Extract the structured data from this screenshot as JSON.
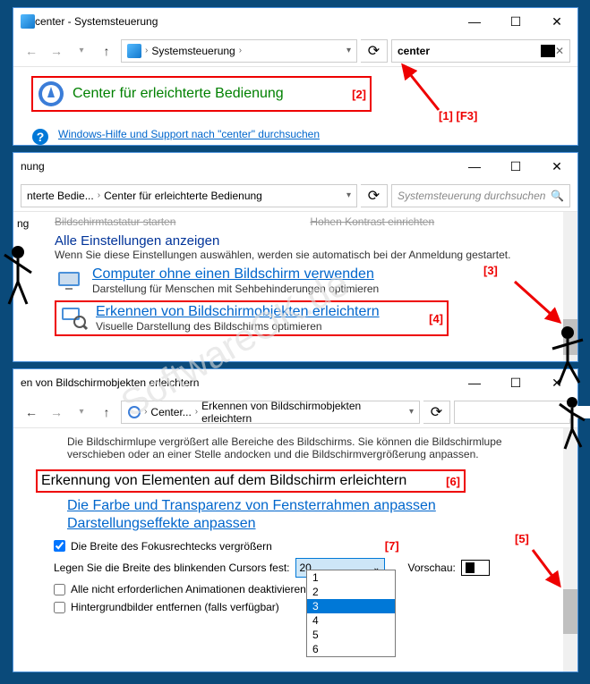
{
  "watermark": "SoftwareOK.de",
  "annotations": {
    "a1": "[1]",
    "a2": "[2]",
    "a3": "[3]",
    "a4": "[4]",
    "a5": "[5]",
    "a6": "[6]",
    "a7": "[7]",
    "f3": "[F3]"
  },
  "win1": {
    "title": "center - Systemsteuerung",
    "crumb1": "Systemsteuerung",
    "search_value": "center",
    "result_heading": "Center für erleichterte Bedienung",
    "help_link": "Windows-Hilfe und Support nach \"center\" durchsuchen"
  },
  "win2": {
    "title_suffix": "nung",
    "crumb1": "nterte Bedie...",
    "crumb2": "Center für erleichterte Bedienung",
    "search_placeholder": "Systemsteuerung durchsuchen",
    "side_item": "ng",
    "partial1": "Bildschirmtastatur starten",
    "partial2": "Hohen Kontrast einrichten",
    "heading": "Alle Einstellungen anzeigen",
    "sub": "Wenn Sie diese Einstellungen auswählen, werden sie automatisch bei der Anmeldung gestartet.",
    "item1_link": "Computer ohne einen Bildschirm verwenden",
    "item1_desc": "Darstellung für Menschen mit Sehbehinderungen optimieren",
    "item2_link": "Erkennen von Bildschirmobjekten erleichtern",
    "item2_desc": "Visuelle Darstellung des Bildschirms optimieren"
  },
  "win3": {
    "title": "en von Bildschirmobjekten erleichtern",
    "crumb1": "Center...",
    "crumb2": "Erkennen von Bildschirmobjekten erleichtern",
    "intro": "Die Bildschirmlupe vergrößert alle Bereiche des Bildschirms. Sie können die Bildschirmlupe verschieben oder an einer Stelle andocken und die Bildschirmvergrößerung anpassen.",
    "section": "Erkennung von Elementen auf dem Bildschirm erleichtern",
    "link1": "Die Farbe und Transparenz von Fensterrahmen anpassen",
    "link2": "Darstellungseffekte anpassen",
    "chk1": "Die Breite des Fokusrechtecks vergrößern",
    "cursor_label": "Legen Sie die Breite des blinkenden Cursors fest:",
    "cursor_value": "20",
    "cursor_options": [
      "1",
      "2",
      "3",
      "4",
      "5",
      "6"
    ],
    "preview_label": "Vorschau:",
    "chk2": "Alle nicht erforderlichen Animationen deaktivieren",
    "chk3": "Hintergrundbilder entfernen (falls verfügbar)"
  }
}
